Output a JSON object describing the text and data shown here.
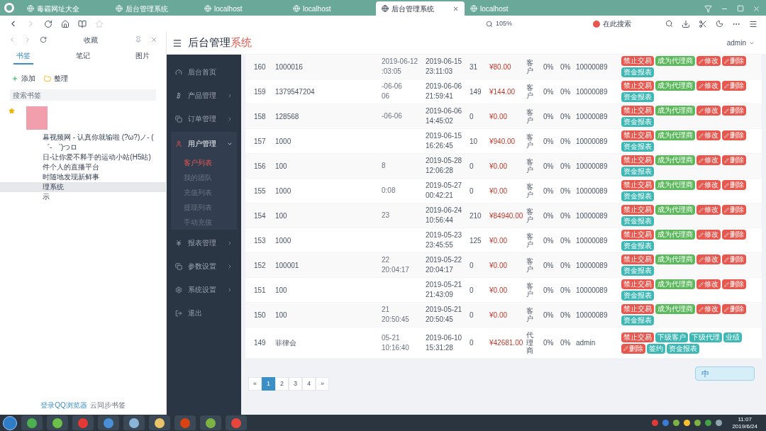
{
  "browser": {
    "tabs": [
      {
        "title": "毒霸网址大全",
        "selected": false
      },
      {
        "title": "后台管理系统",
        "selected": false
      },
      {
        "title": "localhost",
        "selected": false
      },
      {
        "title": "localhost",
        "selected": false
      },
      {
        "title": "后台管理系统",
        "selected": true
      },
      {
        "title": "localhost",
        "selected": false
      }
    ],
    "zoom": "105%",
    "search_placeholder": "在此搜索"
  },
  "favorites": {
    "title": "收藏",
    "tabs": [
      {
        "label": "书签",
        "selected": true
      },
      {
        "label": "笔记",
        "selected": false
      },
      {
        "label": "图片",
        "selected": false
      }
    ],
    "add": "添加",
    "organize": "整理",
    "search_placeholder": "搜索书签",
    "items": [
      {
        "label": "幕视频网 - 认真你就输啦 (?ω?)ノ- ( ゜- ゜)つロ",
        "selected": false
      },
      {
        "label": "日-让你爱不释手的运动小站(H5站)",
        "selected": false
      },
      {
        "label": "件个人的直播平台",
        "selected": false
      },
      {
        "label": "时随地发现新鲜事",
        "selected": false
      },
      {
        "label": "理系统",
        "selected": true
      },
      {
        "label": "示",
        "selected": false
      }
    ],
    "footer_link": "登录QQ浏览器",
    "footer_text": "云同步书签"
  },
  "app": {
    "title": "后台管理",
    "title_accent": "系统",
    "user": "admin"
  },
  "menu": [
    {
      "label": "后台首页"
    },
    {
      "label": "产品管理",
      "expanded": false
    },
    {
      "label": "订单管理",
      "expanded": false
    },
    {
      "label": "用户管理",
      "expanded": true,
      "children": [
        {
          "label": "客户列表",
          "selected": true
        },
        {
          "label": "我的团队",
          "selected": false
        },
        {
          "label": "充值列表",
          "selected": false
        },
        {
          "label": "提现列表",
          "selected": false
        },
        {
          "label": "手动充值",
          "selected": false
        }
      ]
    },
    {
      "label": "报表管理",
      "expanded": false
    },
    {
      "label": "参数设置",
      "expanded": false
    },
    {
      "label": "系统设置",
      "expanded": false
    },
    {
      "label": "退出"
    }
  ],
  "table": {
    "rows": [
      {
        "id": "160",
        "account": "1000016",
        "col_3": [
          "2019-06-12",
          ":03:05"
        ],
        "login_time": [
          "2019-06-15",
          "23:11:03"
        ],
        "count": "31",
        "balance": "¥80.00",
        "type": "客户",
        "rate_1": "0%",
        "rate_2": "0%",
        "parent": "10000089",
        "actions": [
          {
            "label": "禁止交易",
            "kind": "danger"
          },
          {
            "label": "成为代理商",
            "kind": "success"
          },
          {
            "label": "修改",
            "kind": "pencil"
          },
          {
            "label": "删除",
            "kind": "pencil"
          },
          {
            "label": "资金报表",
            "kind": "info"
          }
        ]
      },
      {
        "id": "159",
        "account": "1379547204",
        "col_3": [
          "-06-06",
          "06"
        ],
        "login_time": [
          "2019-06-06",
          "21:59:41"
        ],
        "count": "149",
        "balance": "¥144.00",
        "type": "客户",
        "rate_1": "0%",
        "rate_2": "0%",
        "parent": "10000089",
        "actions": [
          {
            "label": "禁止交易",
            "kind": "danger"
          },
          {
            "label": "成为代理商",
            "kind": "success"
          },
          {
            "label": "修改",
            "kind": "pencil"
          },
          {
            "label": "删除",
            "kind": "pencil"
          },
          {
            "label": "资金报表",
            "kind": "info"
          }
        ]
      },
      {
        "id": "158",
        "account": "128568",
        "col_3": [
          "-06-06"
        ],
        "login_time": [
          "2019-06-06",
          "14:45:02"
        ],
        "count": "0",
        "balance": "¥0.00",
        "type": "客户",
        "rate_1": "0%",
        "rate_2": "0%",
        "parent": "10000089",
        "actions": [
          {
            "label": "禁止交易",
            "kind": "danger"
          },
          {
            "label": "成为代理商",
            "kind": "success"
          },
          {
            "label": "修改",
            "kind": "pencil"
          },
          {
            "label": "删除",
            "kind": "pencil"
          },
          {
            "label": "资金报表",
            "kind": "info"
          }
        ]
      },
      {
        "id": "157",
        "account": "1000",
        "login_time": [
          "2019-06-15",
          "16:26:45"
        ],
        "count": "10",
        "balance": "¥940.00",
        "type": "客户",
        "rate_1": "0%",
        "rate_2": "0%",
        "parent": "10000089",
        "actions": [
          {
            "label": "禁止交易",
            "kind": "danger"
          },
          {
            "label": "成为代理商",
            "kind": "success"
          },
          {
            "label": "修改",
            "kind": "pencil"
          },
          {
            "label": "删除",
            "kind": "pencil"
          },
          {
            "label": "资金报表",
            "kind": "info"
          }
        ]
      },
      {
        "id": "156",
        "account": "100",
        "col_3": [
          "8"
        ],
        "login_time": [
          "2019-05-28",
          "12:06:28"
        ],
        "count": "0",
        "balance": "¥0.00",
        "type": "客户",
        "rate_1": "0%",
        "rate_2": "0%",
        "parent": "10000089",
        "actions": [
          {
            "label": "禁止交易",
            "kind": "danger"
          },
          {
            "label": "成为代理商",
            "kind": "success"
          },
          {
            "label": "修改",
            "kind": "pencil"
          },
          {
            "label": "删除",
            "kind": "pencil"
          },
          {
            "label": "资金报表",
            "kind": "info"
          }
        ]
      },
      {
        "id": "155",
        "account": "1000",
        "col_3": [
          "0:08"
        ],
        "login_time": [
          "2019-05-27",
          "00:42:21"
        ],
        "count": "0",
        "balance": "¥0.00",
        "type": "客户",
        "rate_1": "0%",
        "rate_2": "0%",
        "parent": "10000089",
        "actions": [
          {
            "label": "禁止交易",
            "kind": "danger"
          },
          {
            "label": "成为代理商",
            "kind": "success"
          },
          {
            "label": "修改",
            "kind": "pencil"
          },
          {
            "label": "删除",
            "kind": "pencil"
          },
          {
            "label": "资金报表",
            "kind": "info"
          }
        ]
      },
      {
        "id": "154",
        "account": "100",
        "col_3": [
          "23"
        ],
        "login_time": [
          "2019-06-24",
          "10:56:44"
        ],
        "count": "210",
        "balance": "¥84940.00",
        "type": "客户",
        "rate_1": "0%",
        "rate_2": "0%",
        "parent": "10000089",
        "actions": [
          {
            "label": "禁止交易",
            "kind": "danger"
          },
          {
            "label": "成为代理商",
            "kind": "success"
          },
          {
            "label": "修改",
            "kind": "pencil"
          },
          {
            "label": "删除",
            "kind": "pencil"
          },
          {
            "label": "资金报表",
            "kind": "info"
          }
        ]
      },
      {
        "id": "153",
        "account": "1000",
        "login_time": [
          "2019-05-23",
          "23:45:55"
        ],
        "count": "125",
        "balance": "¥0.00",
        "type": "客户",
        "rate_1": "0%",
        "rate_2": "0%",
        "parent": "10000089",
        "actions": [
          {
            "label": "禁止交易",
            "kind": "danger"
          },
          {
            "label": "成为代理商",
            "kind": "success"
          },
          {
            "label": "修改",
            "kind": "pencil"
          },
          {
            "label": "删除",
            "kind": "pencil"
          },
          {
            "label": "资金报表",
            "kind": "info"
          }
        ]
      },
      {
        "id": "152",
        "account": "100001",
        "col_3": [
          "22",
          "20:04:17"
        ],
        "login_time": [
          "2019-05-22",
          "20:04:17"
        ],
        "count": "0",
        "balance": "¥0.00",
        "type": "客户",
        "rate_1": "0%",
        "rate_2": "0%",
        "parent": "10000089",
        "actions": [
          {
            "label": "禁止交易",
            "kind": "danger"
          },
          {
            "label": "成为代理商",
            "kind": "success"
          },
          {
            "label": "修改",
            "kind": "pencil"
          },
          {
            "label": "删除",
            "kind": "pencil"
          },
          {
            "label": "资金报表",
            "kind": "info"
          }
        ]
      },
      {
        "id": "151",
        "account": "100",
        "login_time": [
          "2019-05-21",
          "21:43:09"
        ],
        "count": "0",
        "balance": "¥0.00",
        "type": "客户",
        "rate_1": "0%",
        "rate_2": "0%",
        "parent": "10000089",
        "actions": [
          {
            "label": "禁止交易",
            "kind": "danger"
          },
          {
            "label": "成为代理商",
            "kind": "success"
          },
          {
            "label": "修改",
            "kind": "pencil"
          },
          {
            "label": "删除",
            "kind": "pencil"
          },
          {
            "label": "资金报表",
            "kind": "info"
          }
        ]
      },
      {
        "id": "150",
        "account": "100",
        "col_3": [
          "21",
          "20:50:45"
        ],
        "login_time": [
          "2019-05-21",
          "20:50:45"
        ],
        "count": "0",
        "balance": "¥0.00",
        "type": "客户",
        "rate_1": "0%",
        "rate_2": "0%",
        "parent": "10000089",
        "actions": [
          {
            "label": "禁止交易",
            "kind": "danger"
          },
          {
            "label": "成为代理商",
            "kind": "success"
          },
          {
            "label": "修改",
            "kind": "pencil"
          },
          {
            "label": "删除",
            "kind": "pencil"
          },
          {
            "label": "资金报表",
            "kind": "info"
          }
        ]
      },
      {
        "id": "149",
        "account": "菲律会",
        "col_3": [
          "05-21",
          "10:16:40"
        ],
        "login_time": [
          "2019-06-10",
          "15:31:28"
        ],
        "count": "0",
        "balance": "¥42681.00",
        "type": "代理商",
        "rate_1": "0%",
        "rate_2": "0%",
        "parent": "admin",
        "actions": [
          {
            "label": "禁止交易",
            "kind": "danger"
          },
          {
            "label": "下级客户",
            "kind": "info"
          },
          {
            "label": "下级代理",
            "kind": "info"
          },
          {
            "label": "业绩",
            "kind": "info"
          },
          {
            "label": "删除",
            "kind": "pencil"
          },
          {
            "label": "签约",
            "kind": "info"
          },
          {
            "label": "资金报表",
            "kind": "info"
          }
        ]
      }
    ]
  },
  "pagination": [
    {
      "label": "«",
      "selected": false
    },
    {
      "label": "1",
      "selected": true
    },
    {
      "label": "2",
      "selected": false
    },
    {
      "label": "3",
      "selected": false
    },
    {
      "label": "4",
      "selected": false
    },
    {
      "label": "»",
      "selected": false
    }
  ],
  "ime": {
    "label": "中"
  },
  "taskbar": {
    "time": "11:07",
    "date": "2019/6/24"
  }
}
